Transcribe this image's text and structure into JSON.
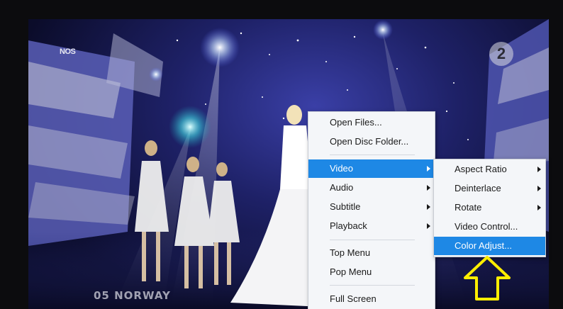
{
  "video": {
    "logo_left": "NOS",
    "logo_right": "2",
    "caption": "05  NORWAY"
  },
  "context_menu": {
    "items": [
      {
        "label": "Open Files...",
        "submenu": false
      },
      {
        "label": "Open Disc Folder...",
        "submenu": false
      },
      {
        "label": "Video",
        "submenu": true,
        "highlighted": true
      },
      {
        "label": "Audio",
        "submenu": true
      },
      {
        "label": "Subtitle",
        "submenu": true
      },
      {
        "label": "Playback",
        "submenu": true
      },
      {
        "label": "Top Menu",
        "submenu": false
      },
      {
        "label": "Pop Menu",
        "submenu": false
      },
      {
        "label": "Full Screen",
        "submenu": false
      }
    ]
  },
  "video_submenu": {
    "items": [
      {
        "label": "Aspect Ratio",
        "submenu": true
      },
      {
        "label": "Deinterlace",
        "submenu": true
      },
      {
        "label": "Rotate",
        "submenu": true
      },
      {
        "label": "Video Control...",
        "submenu": false
      },
      {
        "label": "Color Adjust...",
        "submenu": false,
        "highlighted": true
      }
    ]
  },
  "colors": {
    "highlight": "#1e88e5",
    "pointer_arrow": "#ffee00",
    "menu_background": "#f4f6f9"
  },
  "pointer_arrow_icon": "up-arrow-outline-icon"
}
